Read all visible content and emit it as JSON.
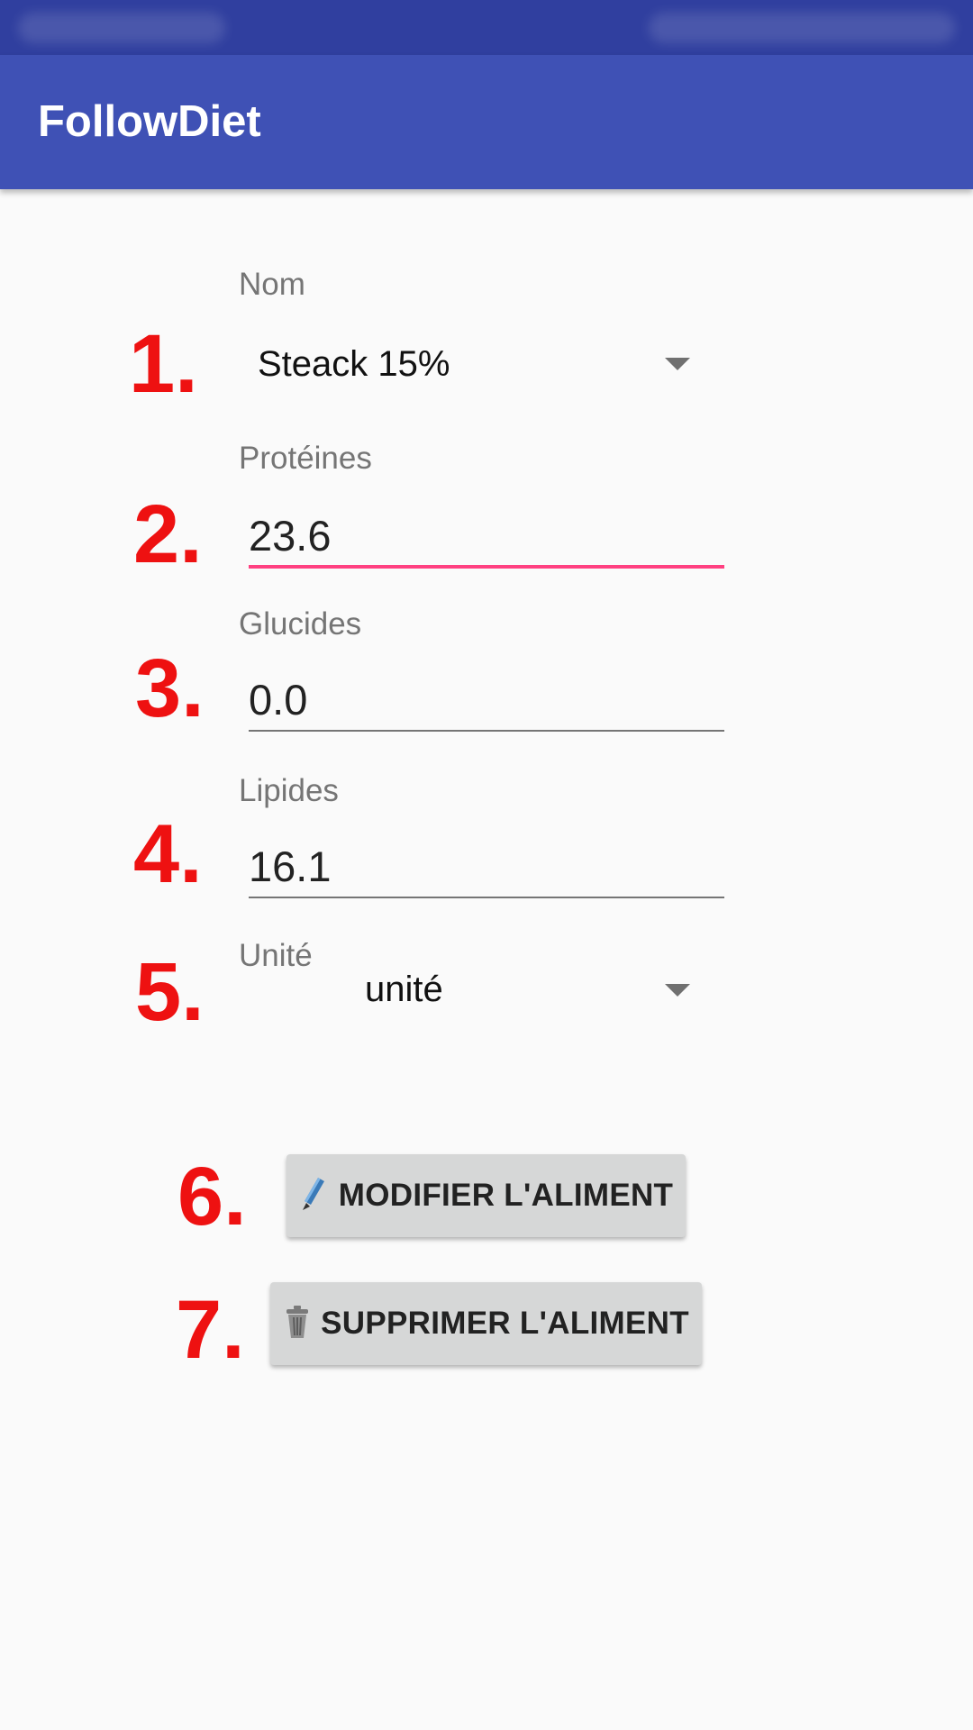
{
  "app_bar": {
    "title": "FollowDiet"
  },
  "form": {
    "nom": {
      "label": "Nom",
      "value": "Steack 15%"
    },
    "proteines": {
      "label": "Protéines",
      "value": "23.6"
    },
    "glucides": {
      "label": "Glucides",
      "value": "0.0"
    },
    "lipides": {
      "label": "Lipides",
      "value": "16.1"
    },
    "unite": {
      "label": "Unité",
      "value": "unité"
    }
  },
  "buttons": {
    "modifier": {
      "label": "MODIFIER L'ALIMENT",
      "icon": "pencil-icon"
    },
    "supprimer": {
      "label": "SUPPRIMER L'ALIMENT",
      "icon": "trash-icon"
    }
  },
  "annotations": [
    "1.",
    "2.",
    "3.",
    "4.",
    "5.",
    "6.",
    "7."
  ],
  "colors": {
    "status_bar": "#303f9f",
    "app_bar": "#3f51b5",
    "accent": "#ff4081",
    "annotation": "#ee1111",
    "button_bg": "#d6d7d7"
  }
}
